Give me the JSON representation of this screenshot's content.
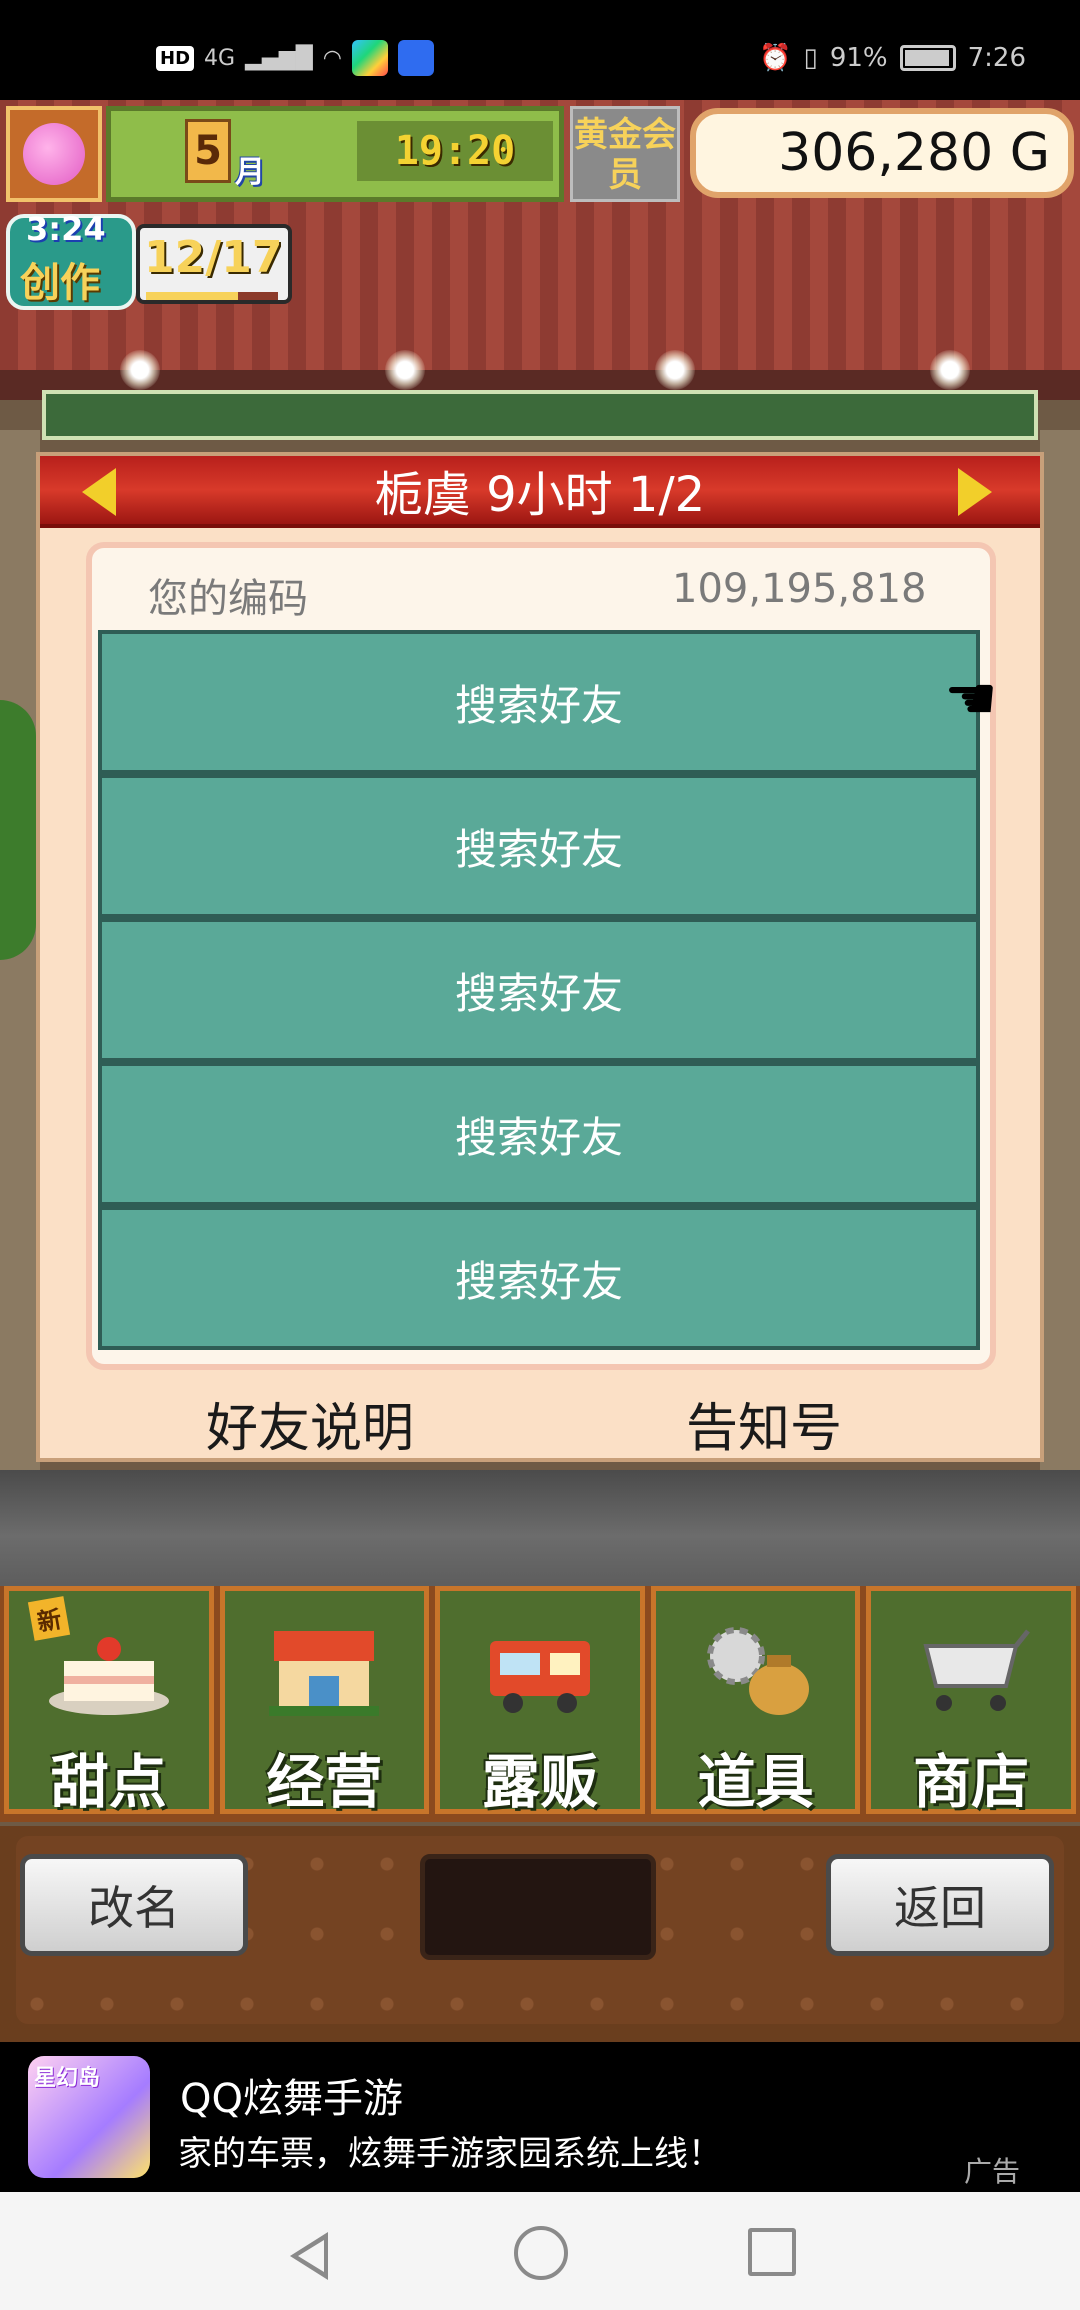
{
  "status_bar": {
    "left_labels": [
      "HD",
      "4G"
    ],
    "battery": "91%",
    "time": "7:26"
  },
  "hud": {
    "month": "5",
    "month_unit": "月",
    "clock": "19:20",
    "gold_member": "黄金会员",
    "money": "306,280 G",
    "create_time": "3:24",
    "create_label": "创作",
    "create_count": "12/17",
    "create_progress": 0.7
  },
  "dialog": {
    "title": "栀虞  9小时 1/2",
    "code_label": "您的编码",
    "code_value": "109,195,818",
    "friend_buttons": [
      "搜索好友",
      "搜索好友",
      "搜索好友",
      "搜索好友",
      "搜索好友"
    ],
    "help_link": "好友说明",
    "notice_link": "告知号"
  },
  "menu": {
    "new_tag": "新",
    "items": [
      {
        "label": "甜点",
        "icon": "cake-icon"
      },
      {
        "label": "经营",
        "icon": "shop-icon"
      },
      {
        "label": "露贩",
        "icon": "food-truck-icon"
      },
      {
        "label": "道具",
        "icon": "gear-bag-icon"
      },
      {
        "label": "商店",
        "icon": "cart-icon"
      }
    ]
  },
  "bottom": {
    "rename": "改名",
    "back": "返回"
  },
  "ad": {
    "logo_text": "星幻岛",
    "title": "QQ炫舞手游",
    "text": "家的车票，炫舞手游家园系统上线！",
    "badge": "广告"
  },
  "colors": {
    "dialog_header": "#c82a22",
    "friend_button": "#5aa998",
    "menu_bg": "#4f6e2e"
  }
}
